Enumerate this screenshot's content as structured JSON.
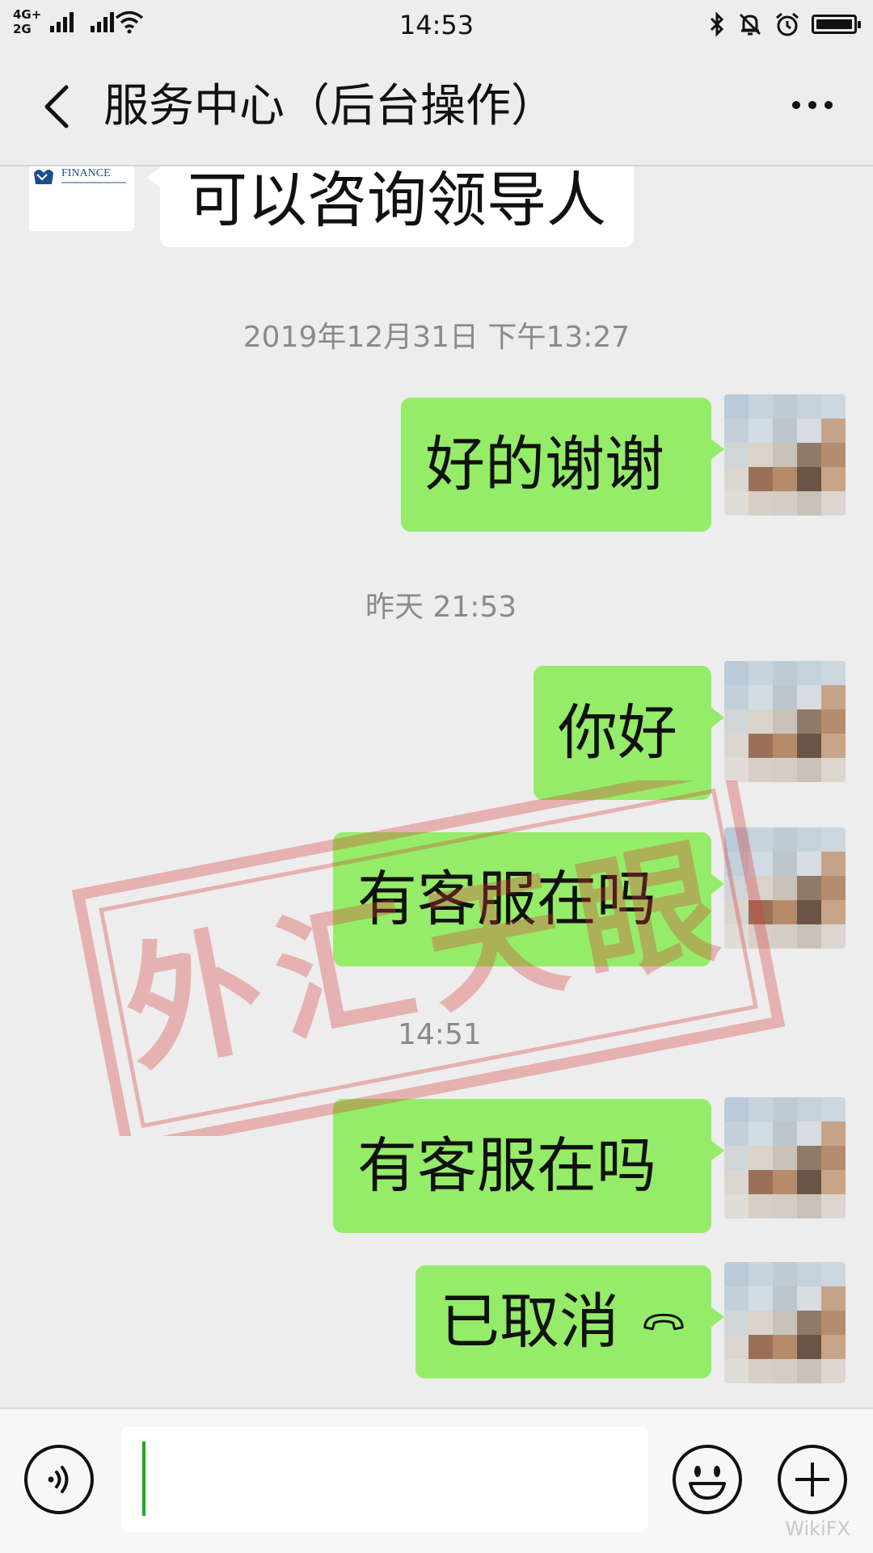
{
  "status_bar": {
    "network_1": "4G+",
    "network_2": "2G",
    "time": "14:53"
  },
  "nav": {
    "title": "服务中心（后台操作）"
  },
  "agent": {
    "logo_text": "FINANCE"
  },
  "messages": [
    {
      "sender": "agent",
      "text": "可以咨询领导人"
    },
    {
      "type": "timestamp",
      "text": "2019年12月31日 下午13:27"
    },
    {
      "sender": "me",
      "text": "好的谢谢"
    },
    {
      "type": "timestamp",
      "text": "昨天 21:53"
    },
    {
      "sender": "me",
      "text": "你好"
    },
    {
      "sender": "me",
      "text": "有客服在吗"
    },
    {
      "type": "timestamp",
      "text": "14:51"
    },
    {
      "sender": "me",
      "text": "有客服在吗"
    },
    {
      "sender": "me",
      "text": "已取消",
      "icon": "hang-up-icon"
    }
  ],
  "watermark": {
    "text": "外汇天眼"
  },
  "input": {
    "value": ""
  },
  "corner_mark": "WikiFX",
  "colors": {
    "background": "#ededed",
    "my_bubble": "#95ec69",
    "their_bubble": "#ffffff",
    "timestamp": "#8a8a8a",
    "caret": "#1aad19",
    "stamp": "#d83a3a"
  }
}
